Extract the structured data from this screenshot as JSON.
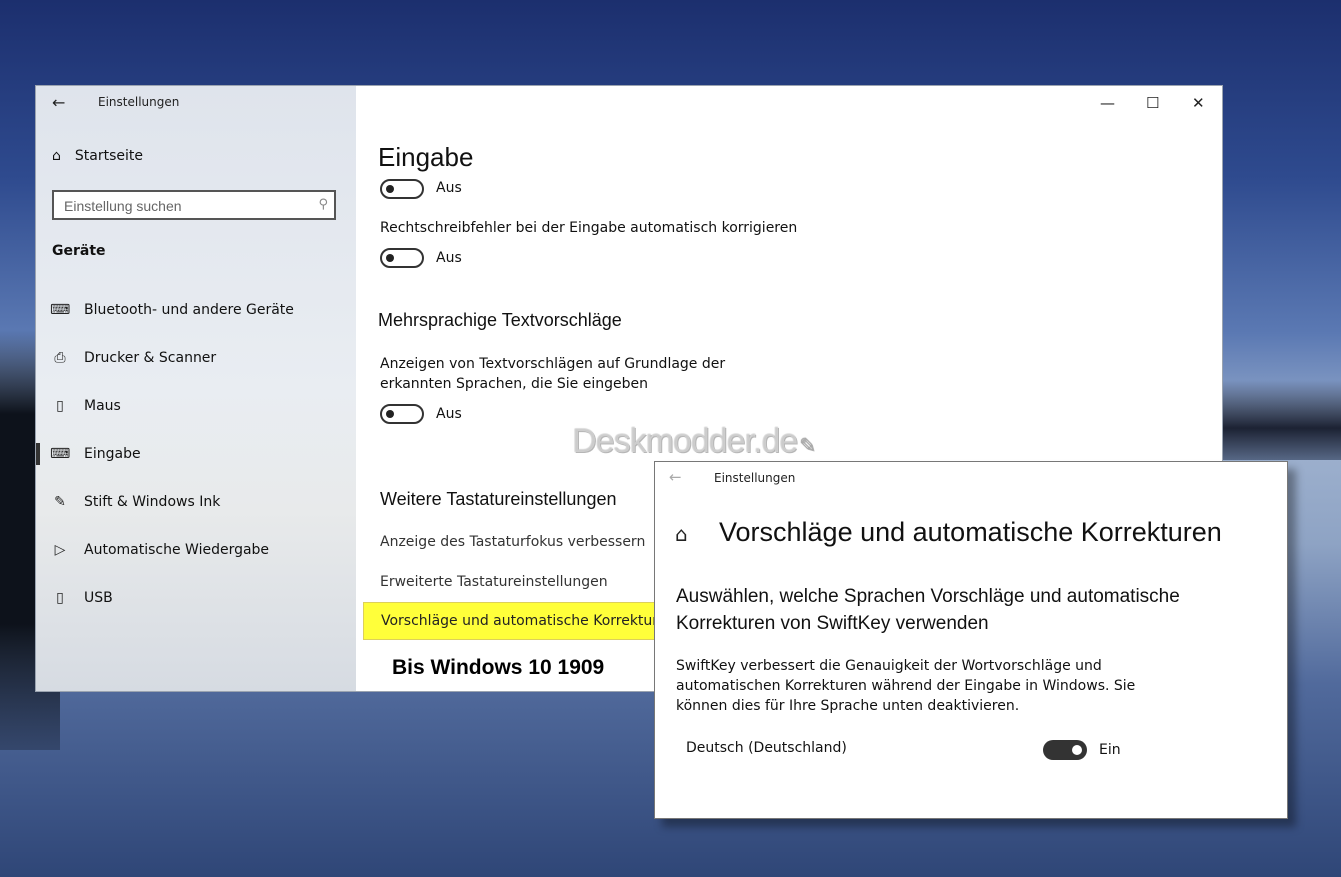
{
  "window": {
    "title": "Einstellungen",
    "back_glyph": "←",
    "controls": {
      "minimize": "—",
      "maximize": "☐",
      "close": "✕"
    }
  },
  "sidebar": {
    "home": "Startseite",
    "search_placeholder": "Einstellung suchen",
    "category": "Geräte",
    "items": [
      {
        "label": "Bluetooth- und andere Geräte",
        "icon": "keyboard-device-icon",
        "glyph": "⌨"
      },
      {
        "label": "Drucker & Scanner",
        "icon": "printer-icon",
        "glyph": "⎙"
      },
      {
        "label": "Maus",
        "icon": "mouse-icon",
        "glyph": "▯"
      },
      {
        "label": "Eingabe",
        "icon": "keyboard-icon",
        "glyph": "⌨",
        "selected": true
      },
      {
        "label": "Stift & Windows Ink",
        "icon": "pen-icon",
        "glyph": "✎"
      },
      {
        "label": "Automatische Wiedergabe",
        "icon": "autoplay-icon",
        "glyph": "▷"
      },
      {
        "label": "USB",
        "icon": "usb-icon",
        "glyph": "▯"
      }
    ]
  },
  "main": {
    "title": "Eingabe",
    "toggle1_state": "Aus",
    "autocorrect_label": "Rechtschreibfehler bei der Eingabe automatisch korrigieren",
    "toggle2_state": "Aus",
    "multilang_heading": "Mehrsprachige Textvorschläge",
    "multilang_desc": "Anzeigen von Textvorschlägen auf Grundlage der erkannten Sprachen, die Sie eingeben",
    "toggle3_state": "Aus",
    "more_heading": "Weitere Tastatureinstellungen",
    "link1": "Anzeige des Tastaturfokus verbessern",
    "link2": "Erweiterte Tastatureinstellungen",
    "link3": "Vorschläge und automatische Korrekturen",
    "caption": "Bis Windows 10 1909"
  },
  "watermark": "Deskmodder.de",
  "popup": {
    "back_glyph": "←",
    "title": "Einstellungen",
    "heading": "Vorschläge und automatische Korrekturen",
    "subheading": "Auswählen, welche Sprachen Vorschläge und automatische Korrekturen von SwiftKey verwenden",
    "description": "SwiftKey verbessert die Genauigkeit der Wortvorschläge und automatischen Korrekturen während der Eingabe in Windows. Sie können dies für Ihre Sprache unten deaktivieren.",
    "language": "Deutsch (Deutschland)",
    "toggle_state": "Ein"
  },
  "colors": {
    "highlight": "#ffff3a",
    "toggle_on": "#333333"
  }
}
